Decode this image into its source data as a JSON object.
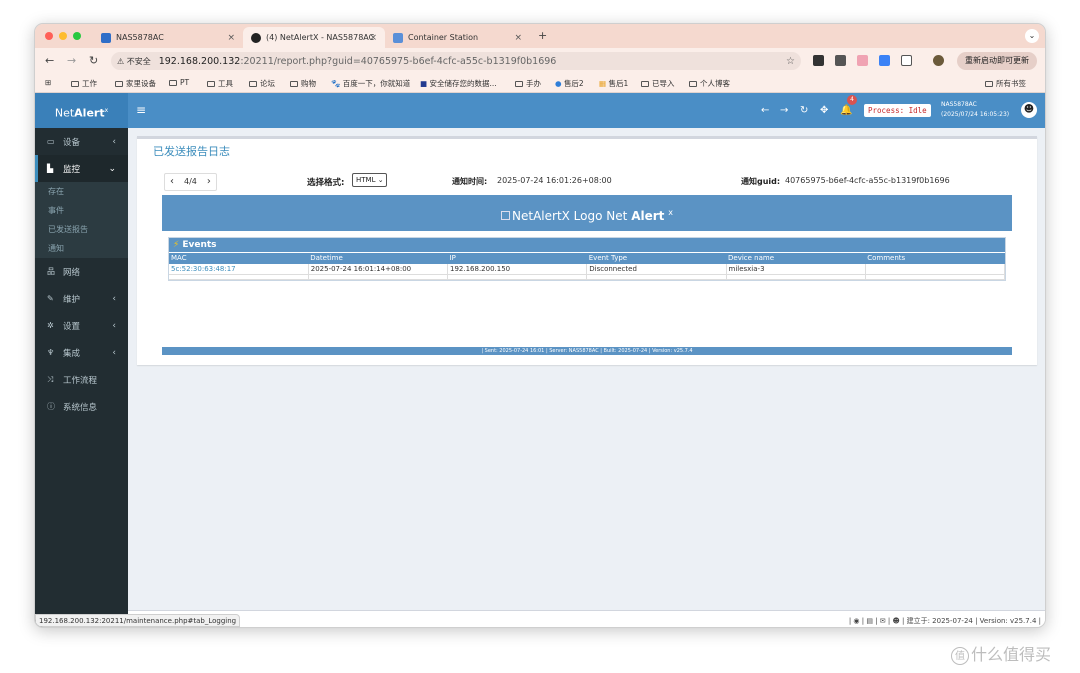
{
  "browser": {
    "tabs": [
      {
        "title": "NAS5878AC",
        "active": false,
        "close": "×"
      },
      {
        "title": "(4) NetAlertX - NAS5878AC",
        "active": true,
        "close": "×"
      },
      {
        "title": "Container Station",
        "active": false,
        "close": "×"
      }
    ],
    "new_tab": "+",
    "tab_menu": "⌄",
    "insecure_label": "不安全",
    "url_host": "192.168.200.132",
    "url_rest": ":20211/report.php?guid=40765975-b6ef-4cfc-a55c-b1319f0b1696",
    "update_button": "重新启动即可更新",
    "bookmarks": [
      "工作",
      "家里设备",
      "PT",
      "工具",
      "论坛",
      "购物",
      "百度一下，你就知道",
      "安全储存您的数据...",
      "手办",
      "售后2",
      "售后1",
      "已导入",
      "个人博客"
    ],
    "all_bookmarks": "所有书签",
    "status_url": "192.168.200.132:20211/maintenance.php#tab_Logging"
  },
  "app": {
    "brand_prefix": "Net",
    "brand_bold": "Alert",
    "brand_sup": "x",
    "hamburger": "≡",
    "notification_count": "4",
    "process_status": "Process: Idle",
    "server_name": "NAS5878AC",
    "server_time": "(2025/07/24 16:05:23)"
  },
  "sidebar": {
    "devices": "设备",
    "monitor": "监控",
    "monitor_sub": [
      "存在",
      "事件",
      "已发送报告",
      "通知"
    ],
    "network": "网络",
    "maintenance": "维护",
    "settings": "设置",
    "integrations": "集成",
    "workflows": "工作流程",
    "sysinfo": "系统信息"
  },
  "report_page": {
    "title": "已发送报告日志",
    "pager_label": "4/4",
    "format_label": "选择格式:",
    "format_value": "HTML",
    "notify_time_label": "通知时间:",
    "notify_time": "2025-07-24 16:01:26+08:00",
    "guid_label": "通知guid:",
    "guid": "40765975-b6ef-4cfc-a55c-b1319f0b1696"
  },
  "report": {
    "logo_alt": "NetAlertX Logo",
    "header_prefix": "Net",
    "header_bold": "Alert",
    "header_sup": "x",
    "events_title": "Events",
    "columns": [
      "MAC",
      "Datetime",
      "IP",
      "Event Type",
      "Device name",
      "Comments"
    ],
    "rows": [
      [
        "5c:52:30:63:48:17",
        "2025-07-24 16:01:14+08:00",
        "192.168.200.150",
        "Disconnected",
        "milesxia-3",
        ""
      ]
    ],
    "footer": "| Sent: 2025-07-24 16:01 | Server: NAS5878AC | Built: 2025-07-24 | Version: v25.7.4"
  },
  "page_footer": "| 建立于: 2025-07-24 | Version: v25.7.4 |",
  "watermark": "什么值得买",
  "watermark_mark": "值",
  "colors": {
    "primary": "#3c8dbc",
    "header": "#4a8ec6",
    "sidebar": "#222d32",
    "report_blue": "#5b93c4"
  }
}
